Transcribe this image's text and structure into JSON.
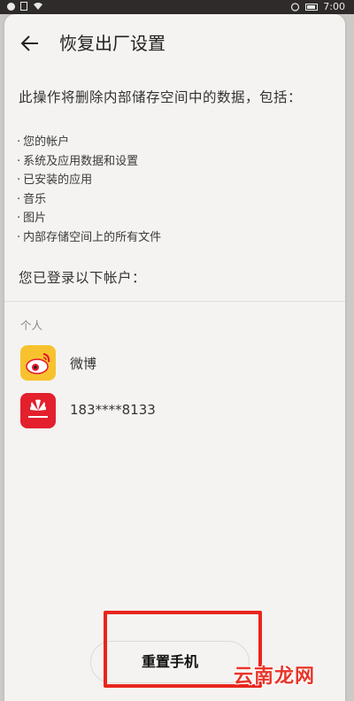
{
  "status_bar": {
    "time": "7:00"
  },
  "header": {
    "title": "恢复出厂设置",
    "back_icon": "arrow-left"
  },
  "intro": "此操作将删除内部储存空间中的数据，包括：",
  "bullets": [
    "您的帐户",
    "系统及应用数据和设置",
    "已安装的应用",
    "音乐",
    "图片",
    "内部存储空间上的所有文件"
  ],
  "logged_in_label": "您已登录以下帐户：",
  "section_label": "个人",
  "accounts": [
    {
      "name": "微博",
      "icon": "weibo-icon",
      "color": "#f8c22e"
    },
    {
      "name": "183****8133",
      "icon": "huawei-icon",
      "color": "#e3202c"
    }
  ],
  "reset_button": "重置手机",
  "watermark": "云南龙网",
  "colors": {
    "highlight": "#e8251c",
    "screen_bg": "#f4f3f1"
  }
}
